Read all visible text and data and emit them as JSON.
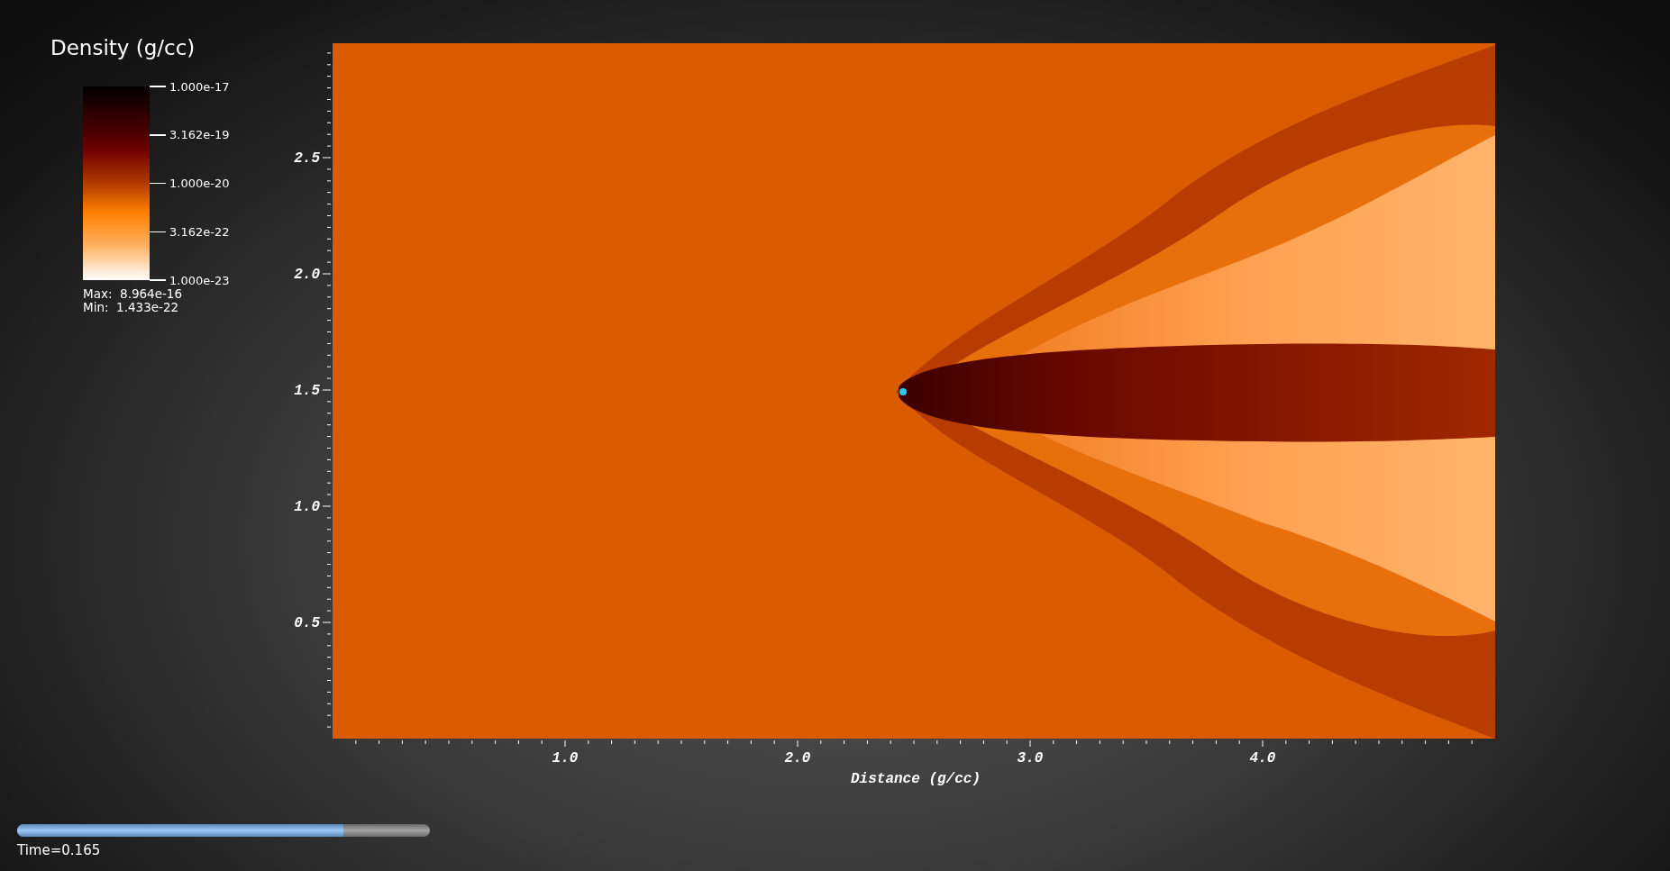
{
  "legend": {
    "title": "Density (g/cc)",
    "ticks": [
      "1.000e-17",
      "3.162e-19",
      "1.000e-20",
      "3.162e-22",
      "1.000e-23"
    ],
    "max": "Max:  8.964e-16",
    "min": "Min:  1.433e-22"
  },
  "plot": {
    "x_axis": {
      "labels": [
        "1.0",
        "2.0",
        "3.0",
        "4.0"
      ],
      "title": "Distance (g/cc)"
    },
    "y_axis": {
      "labels": [
        "2.5",
        "2.0",
        "1.5",
        "1.0",
        "0.5"
      ]
    }
  },
  "time_slider": {
    "level": 0.79,
    "label": "Time=0.165"
  }
}
